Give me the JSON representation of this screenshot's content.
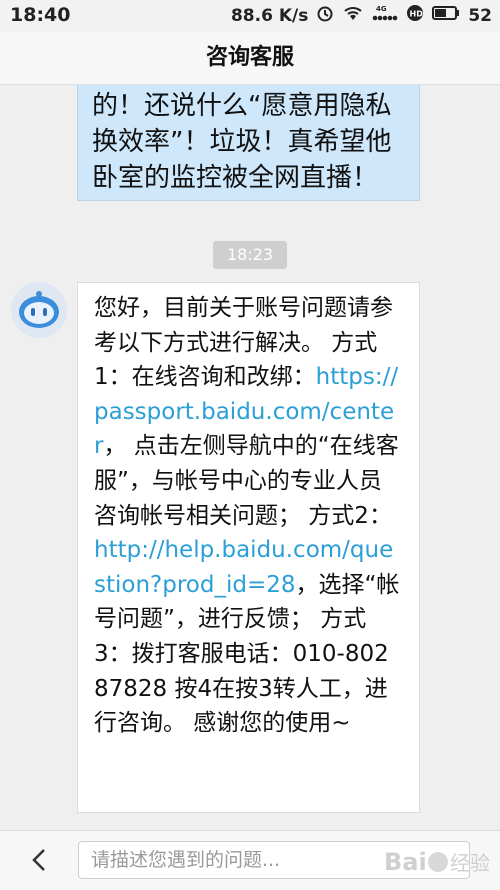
{
  "status_bar": {
    "time": "18:40",
    "speed": "88.6 K/s",
    "battery": "52"
  },
  "header": {
    "title": "咨询客服"
  },
  "messages": {
    "user_message": "的！还说什么“愿意用隐私换效率”！垃圾！真希望他卧室的监控被全网直播！",
    "timestamp": "18:23",
    "bot_message": {
      "part1": "您好，目前关于账号问题请参考以下方式进行解决。 方式1：在线咨询和改绑：",
      "link1": "https://passport.baidu.com/center",
      "part2": "， 点击左侧导航中的“在线客服”，与帐号中心的专业人员咨询帐号相关问题； 方式2：",
      "link2": "http://help.baidu.com/question?prod_id=28",
      "part3": "，选择“帐号问题”，进行反馈； 方式3：拨打客服电话：010-80287828 按4在按3转人工，进行咨询。 感谢您的使用~"
    }
  },
  "composer": {
    "placeholder": "请描述您遇到的问题..."
  },
  "watermark": {
    "text": "Baidu经验"
  },
  "colors": {
    "link": "#2b9fd6",
    "user_bubble": "#cfe7fb",
    "time_chip": "#cfcfcf"
  }
}
